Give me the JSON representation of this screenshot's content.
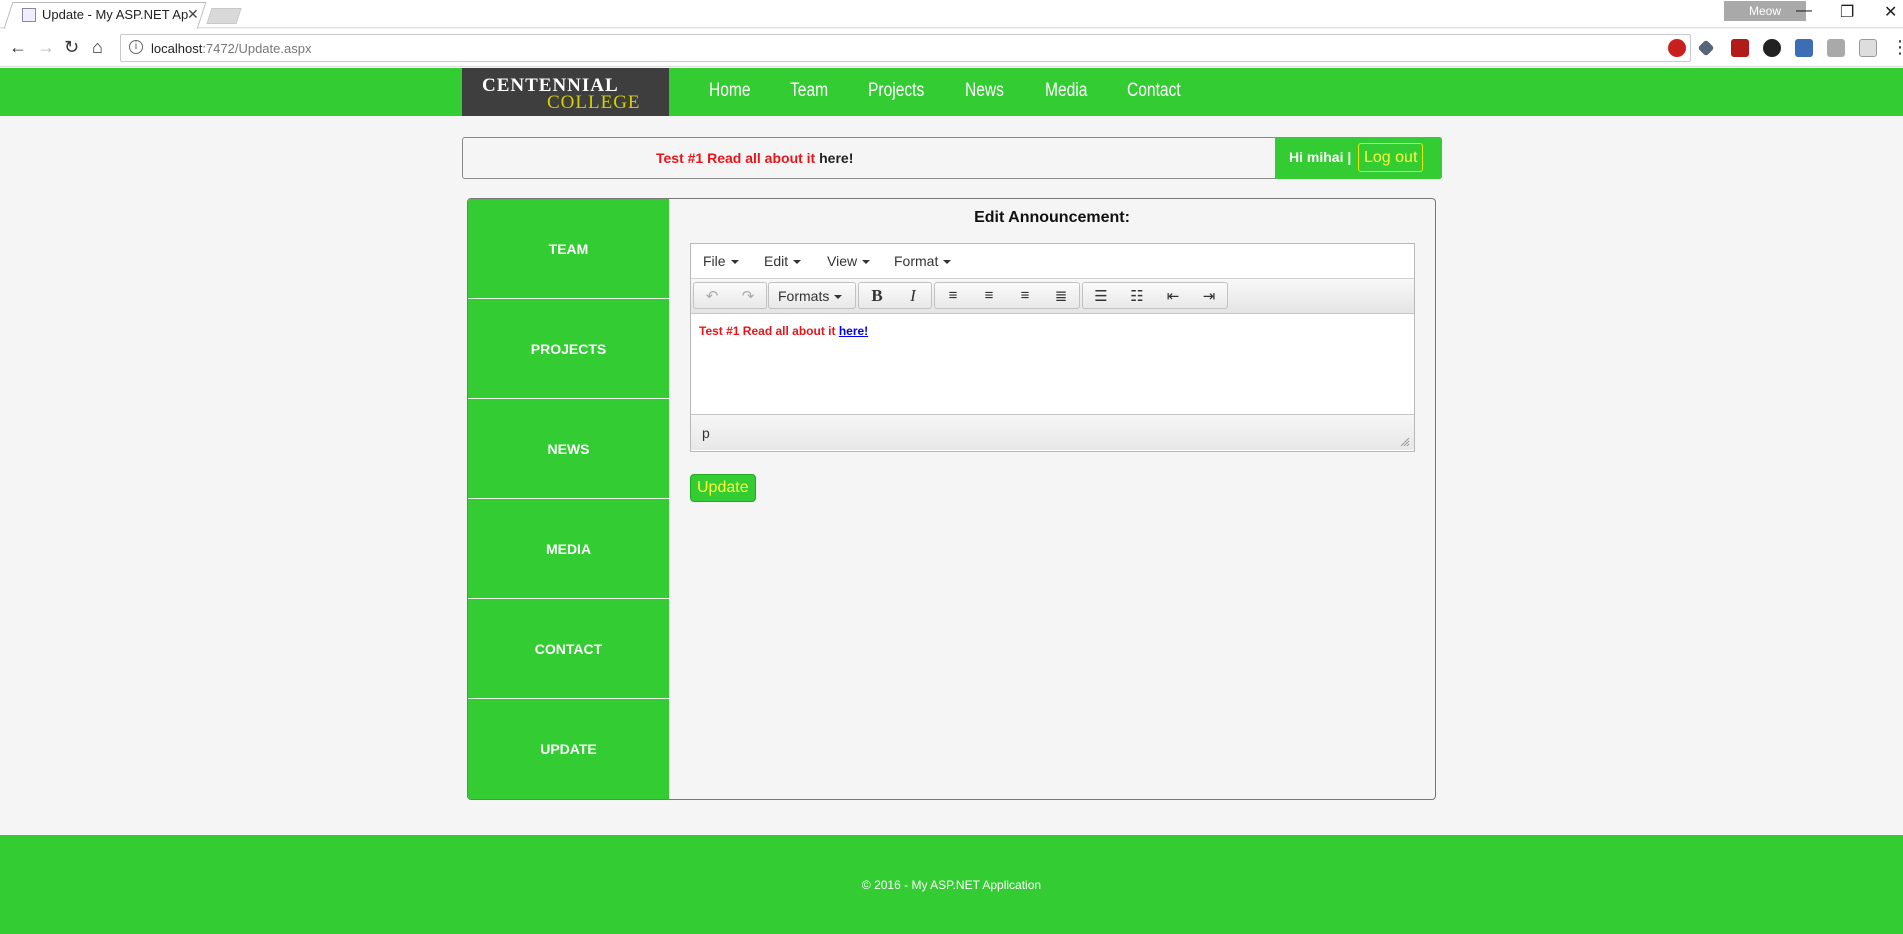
{
  "browser": {
    "tab_title": "Update - My ASP.NET Ap",
    "profile": "Meow",
    "url_host": "localhost",
    "url_path": ":7472/Update.aspx"
  },
  "site": {
    "logo_line1": "CENTENNIAL",
    "logo_line2": "COLLEGE",
    "nav": [
      "Home",
      "Team",
      "Projects",
      "News",
      "Media",
      "Contact"
    ]
  },
  "announcement": {
    "text": "Test #1 Read all about it ",
    "link": "here!"
  },
  "user": {
    "greeting": "Hi mihai |",
    "logout": "Log out"
  },
  "sidebar": {
    "items": [
      "TEAM",
      "PROJECTS",
      "NEWS",
      "MEDIA",
      "CONTACT",
      "UPDATE"
    ]
  },
  "editor": {
    "title": "Edit Announcement:",
    "menus": [
      "File",
      "Edit",
      "View",
      "Format"
    ],
    "formats_label": "Formats",
    "content_text": "Test #1 Read all about it ",
    "content_link": "here!",
    "path": "p",
    "update_button": "Update"
  },
  "footer": {
    "text": "© 2016 - My ASP.NET Application"
  },
  "colors": {
    "brand_green": "#33cc33",
    "logo_bg": "#3e3e3e",
    "accent_yellow": "#ffff3a",
    "announcement_red": "#e8141b"
  }
}
